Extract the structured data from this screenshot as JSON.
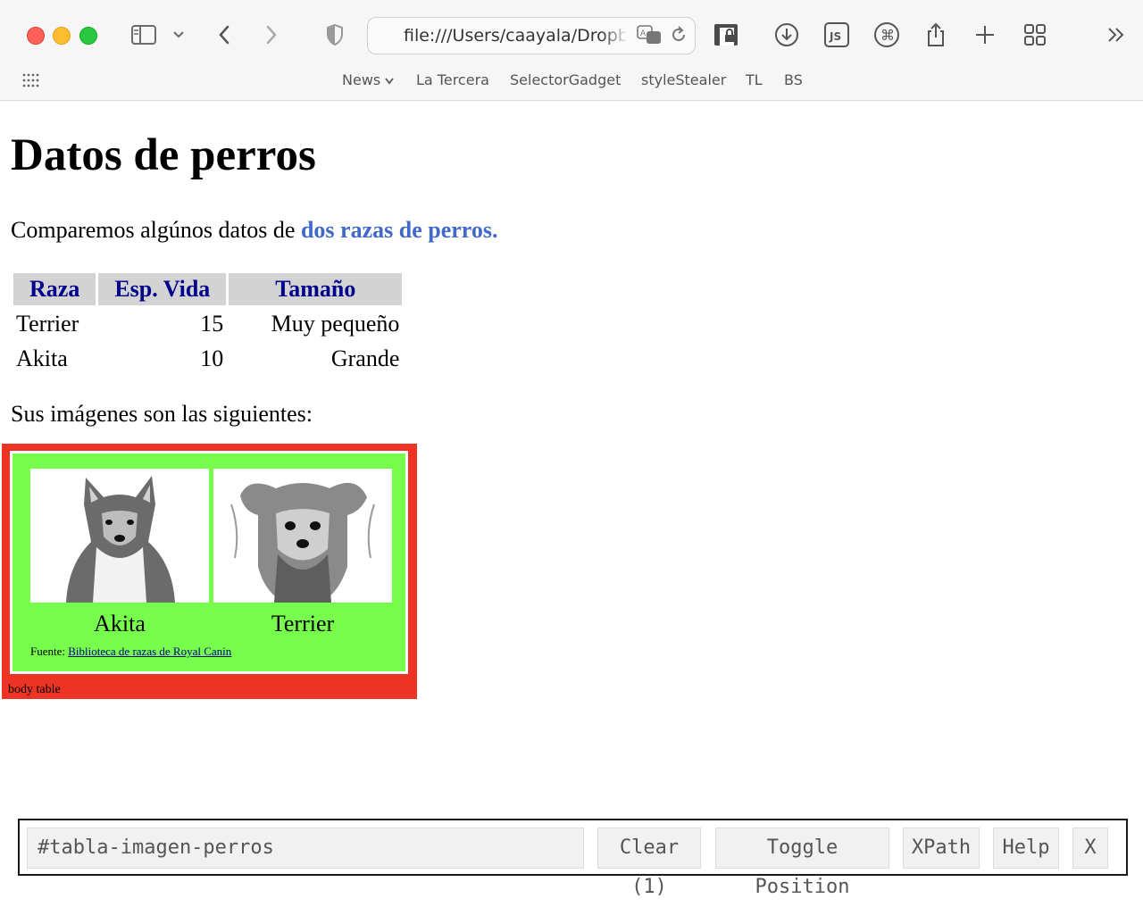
{
  "browser": {
    "url": "file:///Users/caayala/Dropbc",
    "bookmarks": [
      "News",
      "La Tercera",
      "SelectorGadget",
      "styleStealer",
      "TL",
      "BS"
    ],
    "toolbar_js_label": "JS"
  },
  "page": {
    "title": "Datos de perros",
    "intro_text": "Comparemos algúnos datos de ",
    "intro_link": "dos razas de perros.",
    "table": {
      "headers": [
        "Raza",
        "Esp. Vida",
        "Tamaño"
      ],
      "rows": [
        {
          "raza": "Terrier",
          "vida": "15",
          "tamano": "Muy pequeño"
        },
        {
          "raza": "Akita",
          "vida": "10",
          "tamano": "Grande"
        }
      ]
    },
    "images_intro": "Sus imágenes son las siguientes:",
    "images": [
      {
        "caption": "Akita"
      },
      {
        "caption": "Terrier"
      }
    ],
    "source_label": "Fuente: ",
    "source_link": "Biblioteca de razas de Royal Canin",
    "highlight_label": "body table"
  },
  "selector_gadget": {
    "selector": "#tabla-imagen-perros",
    "clear_label": "Clear (1)",
    "toggle_label": "Toggle Position",
    "xpath_label": "XPath",
    "help_label": "Help",
    "close_label": "X"
  },
  "colors": {
    "highlight_red": "#ed3424",
    "selected_green": "#77fe4d",
    "link_blue": "#4169c8",
    "header_text": "#00008b"
  }
}
